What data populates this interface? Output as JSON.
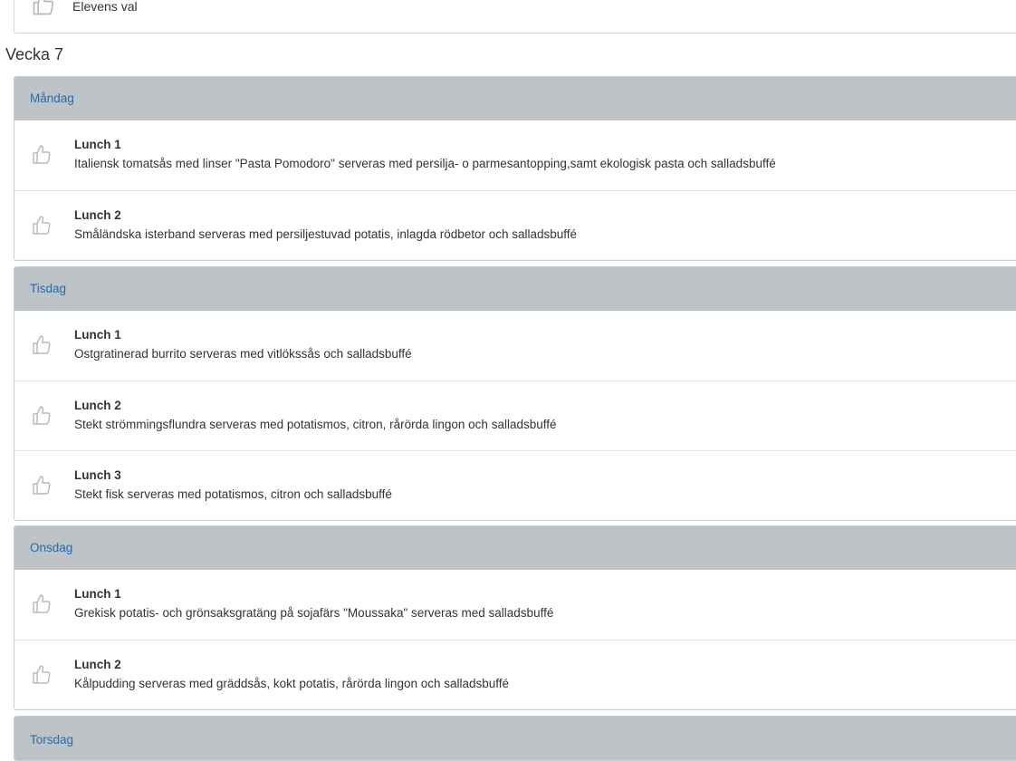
{
  "top_item": {
    "partial_text": "Elevens val"
  },
  "week": {
    "title": "Vecka 7"
  },
  "days": [
    {
      "name": "Måndag",
      "meals": [
        {
          "name": "Lunch 1",
          "description": "Italiensk tomatsås med linser \"Pasta Pomodoro\" serveras med persilja- o parmesantopping,samt ekologisk pasta och salladsbuffé"
        },
        {
          "name": "Lunch 2",
          "description": "Småländska isterband serveras med persiljestuvad potatis, inlagda rödbetor och salladsbuffé"
        }
      ]
    },
    {
      "name": "Tisdag",
      "meals": [
        {
          "name": "Lunch 1",
          "description": "Ostgratinerad burrito serveras med vitlökssås och salladsbuffé"
        },
        {
          "name": "Lunch 2",
          "description": "Stekt strömmingsflundra serveras med potatismos, citron, rårörda lingon och salladsbuffé"
        },
        {
          "name": "Lunch 3",
          "description": "Stekt fisk serveras med potatismos, citron och salladsbuffé"
        }
      ]
    },
    {
      "name": "Onsdag",
      "meals": [
        {
          "name": "Lunch 1",
          "description": "Grekisk potatis- och grönsaksgratäng på sojafärs \"Moussaka\" serveras med salladsbuffé"
        },
        {
          "name": "Lunch 2",
          "description": "Kålpudding serveras med gräddsås, kokt potatis, rårörda lingon och salladsbuffé"
        }
      ]
    },
    {
      "name": "Torsdag",
      "meals": []
    }
  ],
  "icons": {
    "like": "thumbs-up-icon"
  },
  "colors": {
    "header_bg": "#bec3c8",
    "header_text": "#2a6aa8",
    "icon": "#b5b9bd"
  }
}
